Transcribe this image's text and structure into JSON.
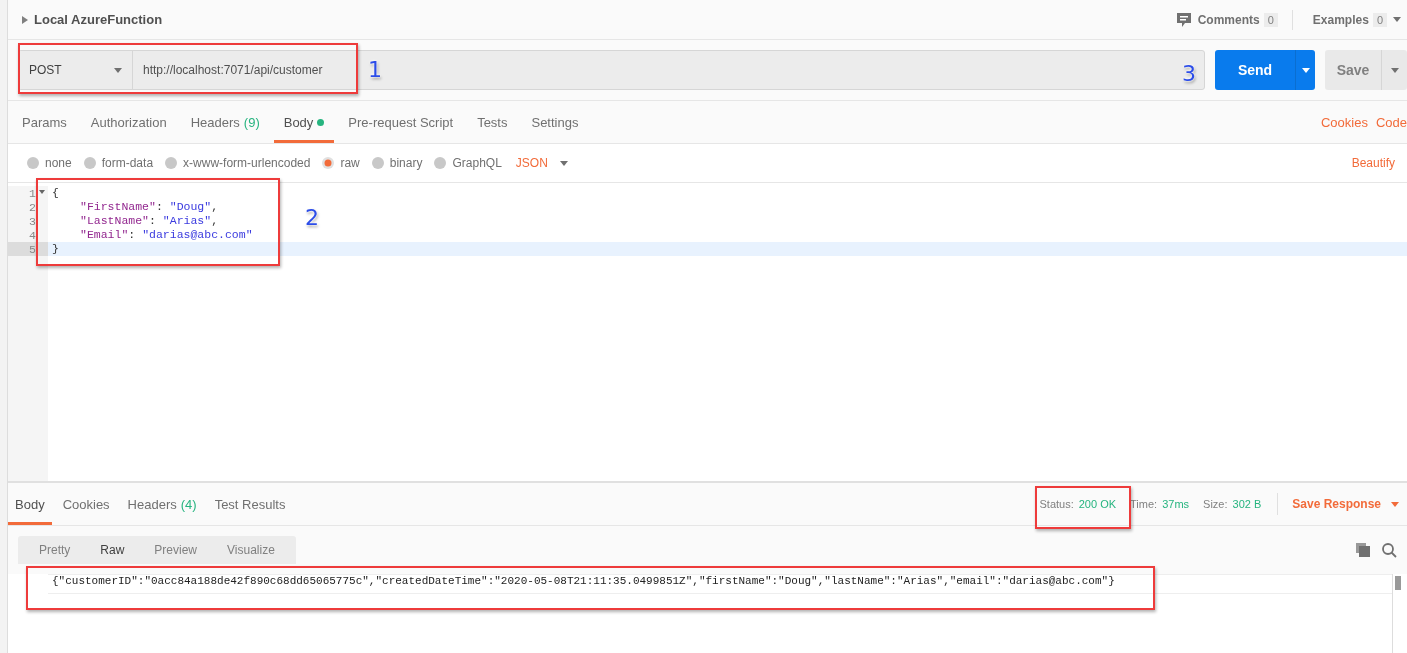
{
  "request": {
    "title": "Local AzureFunction",
    "comments": {
      "label": "Comments",
      "count": "0"
    },
    "examples": {
      "label": "Examples",
      "count": "0"
    },
    "method": "POST",
    "url": "http://localhost:7071/api/customer",
    "send": "Send",
    "save": "Save"
  },
  "request_tabs": [
    {
      "label": "Params",
      "has_content": false,
      "selected": false
    },
    {
      "label": "Authorization",
      "has_content": false,
      "selected": false
    },
    {
      "label": "Headers",
      "count": "(9)",
      "has_content": false,
      "selected": false
    },
    {
      "label": "Body",
      "has_content": true,
      "selected": true
    },
    {
      "label": "Pre-request Script",
      "has_content": false,
      "selected": false
    },
    {
      "label": "Tests",
      "has_content": false,
      "selected": false
    },
    {
      "label": "Settings",
      "has_content": false,
      "selected": false
    }
  ],
  "request_links": [
    "Cookies",
    "Code"
  ],
  "body_types": [
    {
      "label": "none",
      "selected": false
    },
    {
      "label": "form-data",
      "selected": false
    },
    {
      "label": "x-www-form-urlencoded",
      "selected": false
    },
    {
      "label": "raw",
      "selected": true
    },
    {
      "label": "binary",
      "selected": false
    },
    {
      "label": "GraphQL",
      "selected": false
    }
  ],
  "format": "JSON",
  "beautify": "Beautify",
  "editor": {
    "lines": [
      {
        "number": "1",
        "foldable": true,
        "active": false,
        "indented": false,
        "tokens": [
          {
            "kind": "punct",
            "text": "{"
          }
        ]
      },
      {
        "number": "2",
        "foldable": false,
        "active": false,
        "indented": true,
        "tokens": [
          {
            "kind": "key",
            "text": "\"FirstName\""
          },
          {
            "kind": "punct",
            "text": ": "
          },
          {
            "kind": "string",
            "text": "\"Doug\""
          },
          {
            "kind": "punct",
            "text": ","
          }
        ]
      },
      {
        "number": "3",
        "foldable": false,
        "active": false,
        "indented": true,
        "tokens": [
          {
            "kind": "key",
            "text": "\"LastName\""
          },
          {
            "kind": "punct",
            "text": ": "
          },
          {
            "kind": "string",
            "text": "\"Arias\""
          },
          {
            "kind": "punct",
            "text": ","
          }
        ]
      },
      {
        "number": "4",
        "foldable": false,
        "active": false,
        "indented": true,
        "tokens": [
          {
            "kind": "key",
            "text": "\"Email\""
          },
          {
            "kind": "punct",
            "text": ": "
          },
          {
            "kind": "string",
            "text": "\"darias@abc.com\""
          }
        ]
      },
      {
        "number": "5",
        "foldable": false,
        "active": true,
        "indented": false,
        "tokens": [
          {
            "kind": "punct",
            "text": "}"
          }
        ]
      }
    ]
  },
  "response_tabs": [
    {
      "label": "Body",
      "selected": true
    },
    {
      "label": "Cookies",
      "selected": false
    },
    {
      "label": "Headers",
      "count": "(4)",
      "selected": false
    },
    {
      "label": "Test Results",
      "selected": false
    }
  ],
  "response_meta": [
    {
      "label": "Status:",
      "value": "200 OK"
    },
    {
      "label": "Time:",
      "value": "37ms"
    },
    {
      "label": "Size:",
      "value": "302 B"
    }
  ],
  "save_response": "Save Response",
  "view_modes": [
    {
      "label": "Pretty",
      "selected": false
    },
    {
      "label": "Raw",
      "selected": true
    },
    {
      "label": "Preview",
      "selected": false
    },
    {
      "label": "Visualize",
      "selected": false
    }
  ],
  "response_body": "{\"customerID\":\"0acc84a188de42f890c68dd65065775c\",\"createdDateTime\":\"2020-05-08T21:11:35.0499851Z\",\"firstName\":\"Doug\",\"lastName\":\"Arias\",\"email\":\"darias@abc.com\"}",
  "callouts": [
    "1",
    "2",
    "3"
  ]
}
